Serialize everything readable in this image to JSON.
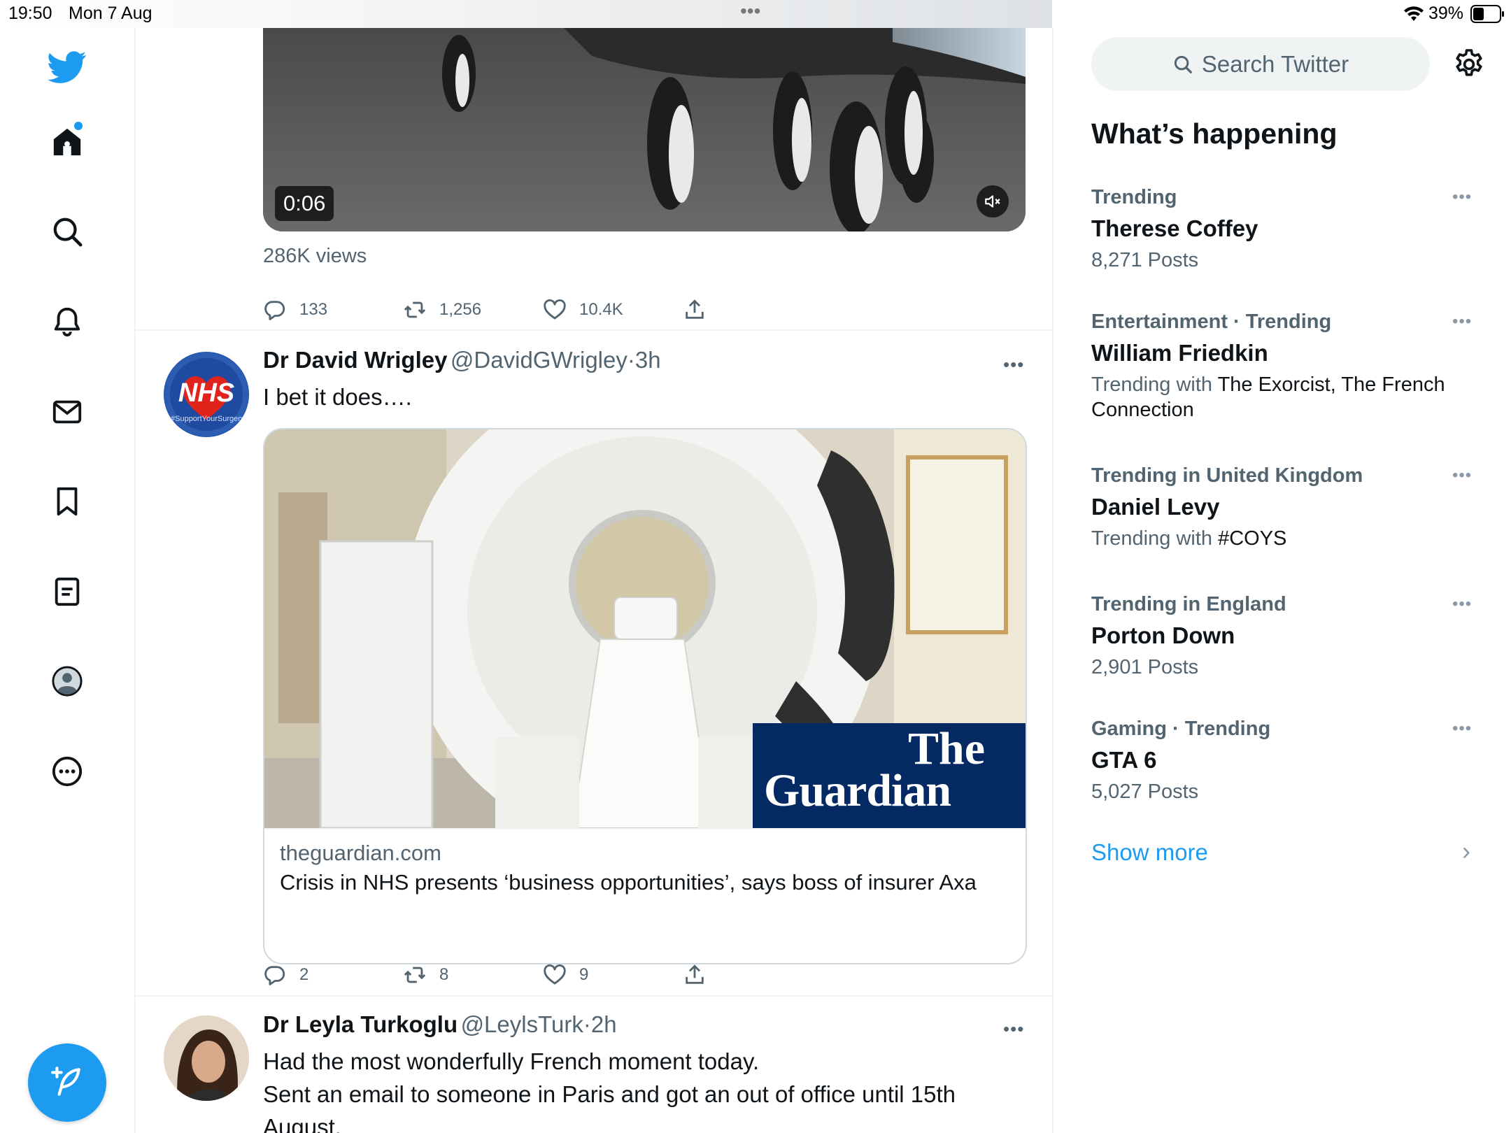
{
  "status_bar": {
    "time": "19:50",
    "date": "Mon 7 Aug",
    "battery": "39%",
    "center_dots": "•••"
  },
  "nav": {
    "items": [
      {
        "name": "home-icon"
      },
      {
        "name": "search-icon"
      },
      {
        "name": "notifications-icon"
      },
      {
        "name": "messages-icon"
      },
      {
        "name": "bookmarks-icon"
      },
      {
        "name": "lists-icon"
      },
      {
        "name": "profile-icon"
      },
      {
        "name": "more-icon"
      }
    ],
    "brand_color": "#1d9bf0"
  },
  "feed": {
    "video_tweet": {
      "duration": "0:06",
      "views": "286K views",
      "replies": "133",
      "retweets": "1,256",
      "likes": "10.4K"
    },
    "tweet2": {
      "name": "Dr David Wrigley",
      "handle": "@DavidGWrigley",
      "sep": "·",
      "time": "3h",
      "text": "I bet it does….",
      "avatar_text": "NHS",
      "avatar_sub": "#SupportYourSurgery",
      "card": {
        "logo_line1": "The",
        "logo_line2": "Guardian",
        "domain": "theguardian.com",
        "headline": "Crisis in NHS presents ‘business opportunities’, says boss of insurer Axa"
      },
      "replies": "2",
      "retweets": "8",
      "likes": "9"
    },
    "tweet3": {
      "name": "Dr Leyla Turkoglu",
      "handle": "@LeylsTurk",
      "sep": "·",
      "time": "2h",
      "text_line1": "Had the most wonderfully French moment today.",
      "text_line2": "Sent an email to someone in Paris and got an out of office until 15th",
      "text_line3": "August."
    },
    "more_dots": "•••"
  },
  "right": {
    "search_placeholder": "Search Twitter",
    "heading": "What’s happening",
    "trends": [
      {
        "context": "Trending",
        "name": "Therese Coffey",
        "sub": "8,271 Posts"
      },
      {
        "context": "Entertainment · Trending",
        "name": "William Friedkin",
        "sub_prefix": "Trending with",
        "sub_value": "The Exorcist, The French Connection"
      },
      {
        "context": "Trending in United Kingdom",
        "name": "Daniel Levy",
        "sub_prefix": "Trending with",
        "sub_value": "#COYS"
      },
      {
        "context": "Trending in England",
        "name": "Porton Down",
        "sub": "2,901 Posts"
      },
      {
        "context": "Gaming · Trending",
        "name": "GTA 6",
        "sub": "5,027 Posts"
      }
    ],
    "show_more": "Show more",
    "chevron": "›",
    "more_dots": "•••"
  }
}
